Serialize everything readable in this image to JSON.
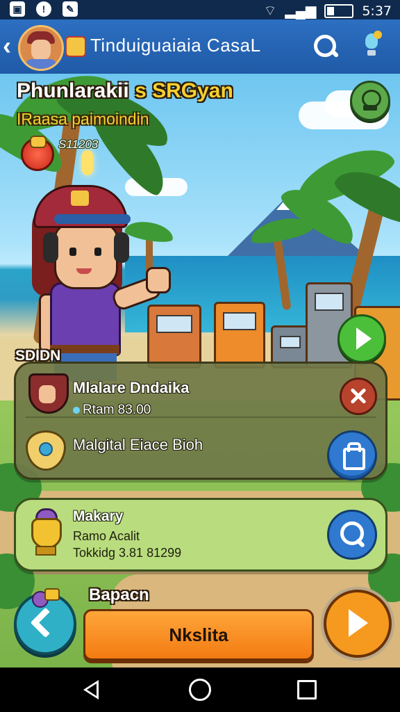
{
  "status_bar": {
    "time": "5:37"
  },
  "app_bar": {
    "title": "Tinduiguaiaia CasaL"
  },
  "hud": {
    "game_title_main": "Phunlarakii",
    "game_title_accent": "s SRGyan",
    "subtitle": "IRaasa paimoindin",
    "coin_value": "S11203",
    "section_label": "SDIDN"
  },
  "panel_one": {
    "row1_title": "Mlalare Dndaika",
    "row1_sub": "Rtam 83.00",
    "row2_title": "Malgital Eiace Bioh"
  },
  "panel_two": {
    "title": "Makary",
    "line_a": "Ramo Acalit",
    "line_b": "Tokkidg 3.81 81299"
  },
  "bottom": {
    "label": "Bapacn",
    "main_button": "Nkslita"
  },
  "icons": {
    "back": "chevron-left-icon",
    "search": "search-icon",
    "hint": "lightbulb-icon",
    "badge": "trophy-badge-icon",
    "play": "play-icon",
    "close": "close-icon",
    "bag": "bag-icon",
    "zoom": "magnifier-icon",
    "next": "next-arrow-icon"
  },
  "colors": {
    "header": "#2d6fc2",
    "accent_yellow": "#f6d02f",
    "primary_button": "#f27b12",
    "play_green": "#4bbf3a",
    "close_red": "#b8432c",
    "action_blue": "#2f7ad0"
  }
}
